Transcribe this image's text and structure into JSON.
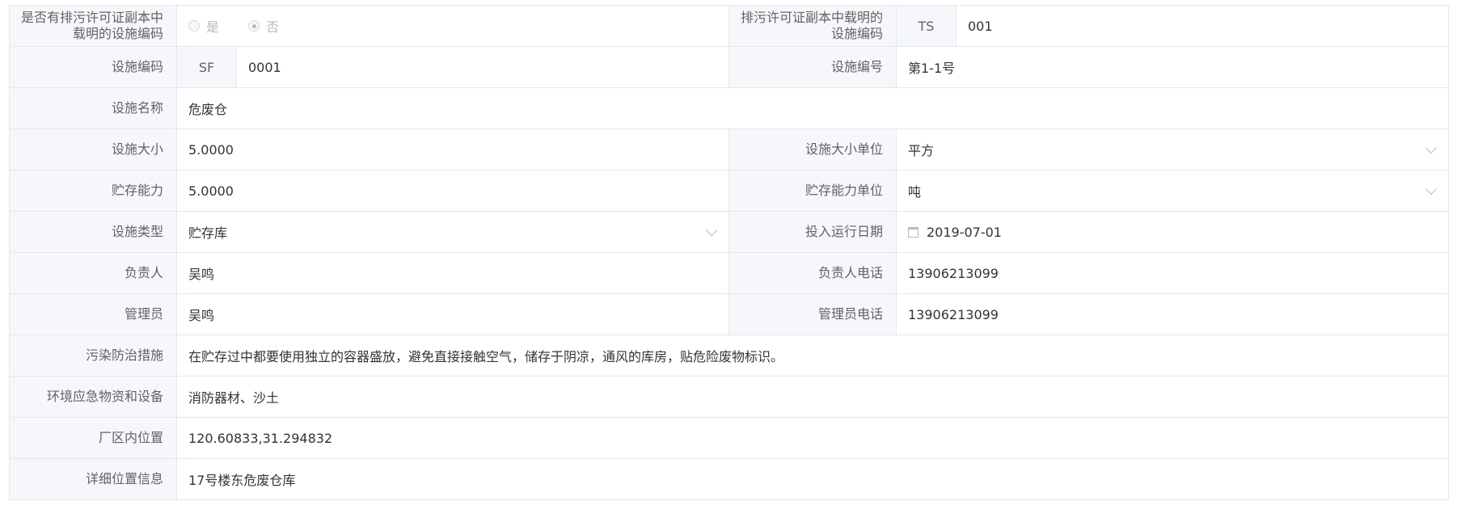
{
  "rows": {
    "permit": {
      "label": "是否有排污许可证副本中载明的设施编码",
      "radio_yes": "是",
      "radio_no": "否",
      "right_label": "排污许可证副本中载明的设施编码",
      "right_prefix": "TS",
      "right_value": "001"
    },
    "code": {
      "label": "设施编码",
      "prefix": "SF",
      "value": "0001",
      "right_label": "设施编号",
      "right_value": "第1-1号"
    },
    "name": {
      "label": "设施名称",
      "value": "危废仓"
    },
    "size": {
      "label": "设施大小",
      "value": "5.0000",
      "right_label": "设施大小单位",
      "right_value": "平方"
    },
    "capacity": {
      "label": "贮存能力",
      "value": "5.0000",
      "right_label": "贮存能力单位",
      "right_value": "吨"
    },
    "type": {
      "label": "设施类型",
      "value": "贮存库",
      "right_label": "投入运行日期",
      "right_value": "2019-07-01"
    },
    "owner": {
      "label": "负责人",
      "value": "吴鸣",
      "right_label": "负责人电话",
      "right_value": "13906213099"
    },
    "admin": {
      "label": "管理员",
      "value": "吴鸣",
      "right_label": "管理员电话",
      "right_value": "13906213099"
    },
    "measures": {
      "label": "污染防治措施",
      "value": "在贮存过中都要使用独立的容器盛放，避免直接接触空气，储存于阴凉，通风的库房，贴危险废物标识。"
    },
    "emergency": {
      "label": "环境应急物资和设备",
      "value": "消防器材、沙土"
    },
    "location": {
      "label": "厂区内位置",
      "value": "120.60833,31.294832"
    },
    "detail": {
      "label": "详细位置信息",
      "value": "17号楼东危废仓库"
    }
  }
}
